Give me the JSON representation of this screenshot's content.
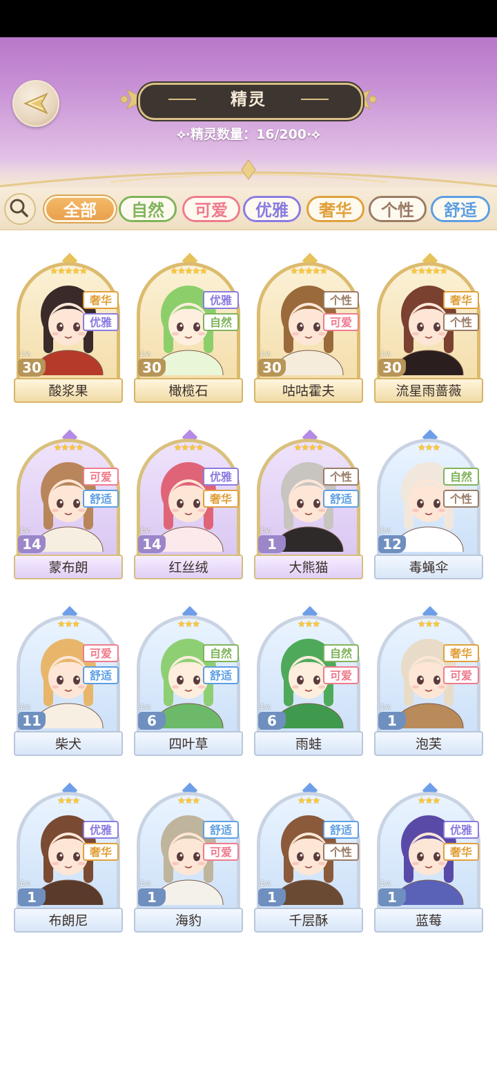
{
  "header": {
    "title": "精灵",
    "count_label": "精灵数量：",
    "count_value": "16/200"
  },
  "filters": [
    {
      "label": "全部",
      "selected": true,
      "color": "#e9a04c"
    },
    {
      "label": "自然",
      "selected": false,
      "color": "#7fb35a"
    },
    {
      "label": "可爱",
      "selected": false,
      "color": "#ef7b8d"
    },
    {
      "label": "优雅",
      "selected": false,
      "color": "#8a7be0"
    },
    {
      "label": "奢华",
      "selected": false,
      "color": "#e0a03a"
    },
    {
      "label": "个性",
      "selected": false,
      "color": "#9a7b66"
    },
    {
      "label": "舒适",
      "selected": false,
      "color": "#5b9ee3"
    }
  ],
  "tag_colors": {
    "奢华": "#e0a03a",
    "优雅": "#8a7be0",
    "自然": "#7fb35a",
    "个性": "#9a7b66",
    "可爱": "#ef7b8d",
    "舒适": "#5b9ee3"
  },
  "level_prefix": "Lv.",
  "spirits": [
    {
      "name": "酸浆果",
      "level": "30",
      "stars": 5,
      "rarity": "gold",
      "tags": [
        "奢华",
        "优雅"
      ]
    },
    {
      "name": "橄榄石",
      "level": "30",
      "stars": 5,
      "rarity": "gold",
      "tags": [
        "优雅",
        "自然"
      ]
    },
    {
      "name": "咕咕霍夫",
      "level": "30",
      "stars": 5,
      "rarity": "gold",
      "tags": [
        "个性",
        "可爱"
      ]
    },
    {
      "name": "流星雨蔷薇",
      "level": "30",
      "stars": 5,
      "rarity": "gold",
      "tags": [
        "奢华",
        "个性"
      ]
    },
    {
      "name": "蒙布朗",
      "level": "14",
      "stars": 4,
      "rarity": "purple",
      "tags": [
        "可爱",
        "舒适"
      ]
    },
    {
      "name": "红丝绒",
      "level": "14",
      "stars": 4,
      "rarity": "purple",
      "tags": [
        "优雅",
        "奢华"
      ]
    },
    {
      "name": "大熊猫",
      "level": "1",
      "stars": 4,
      "rarity": "purple",
      "tags": [
        "个性",
        "舒适"
      ]
    },
    {
      "name": "毒蝇伞",
      "level": "12",
      "stars": 3,
      "rarity": "blue",
      "tags": [
        "自然",
        "个性"
      ]
    },
    {
      "name": "柴犬",
      "level": "11",
      "stars": 3,
      "rarity": "blue",
      "tags": [
        "可爱",
        "舒适"
      ]
    },
    {
      "name": "四叶草",
      "level": "6",
      "stars": 3,
      "rarity": "blue",
      "tags": [
        "自然",
        "舒适"
      ]
    },
    {
      "name": "雨蛙",
      "level": "6",
      "stars": 3,
      "rarity": "blue",
      "tags": [
        "自然",
        "可爱"
      ]
    },
    {
      "name": "泡芙",
      "level": "1",
      "stars": 3,
      "rarity": "blue",
      "tags": [
        "奢华",
        "可爱"
      ]
    },
    {
      "name": "布朗尼",
      "level": "1",
      "stars": 3,
      "rarity": "blue",
      "tags": [
        "优雅",
        "奢华"
      ]
    },
    {
      "name": "海豹",
      "level": "1",
      "stars": 3,
      "rarity": "blue",
      "tags": [
        "舒适",
        "可爱"
      ]
    },
    {
      "name": "千层酥",
      "level": "1",
      "stars": 3,
      "rarity": "blue",
      "tags": [
        "舒适",
        "个性"
      ]
    },
    {
      "name": "蓝莓",
      "level": "1",
      "stars": 3,
      "rarity": "blue",
      "tags": [
        "优雅",
        "奢华"
      ]
    }
  ],
  "portrait_palette": {
    "酸浆果": {
      "hair": "#3a2a2a",
      "skin": "#fde6d6",
      "outfit": "#b53a2a"
    },
    "橄榄石": {
      "hair": "#8ccf6a",
      "skin": "#fdeedd",
      "outfit": "#e9f6d8"
    },
    "咕咕霍夫": {
      "hair": "#9a6a3a",
      "skin": "#fde6d6",
      "outfit": "#f5ecdc"
    },
    "流星雨蔷薇": {
      "hair": "#7a4030",
      "skin": "#fde6d6",
      "outfit": "#2a1e1e"
    },
    "蒙布朗": {
      "hair": "#b8865a",
      "skin": "#fde6d6",
      "outfit": "#f6efe1"
    },
    "红丝绒": {
      "hair": "#e06478",
      "skin": "#fde6d6",
      "outfit": "#fbe9ec"
    },
    "大熊猫": {
      "hair": "#c8c4c0",
      "skin": "#fde6d6",
      "outfit": "#2e2a2a"
    },
    "毒蝇伞": {
      "hair": "#f1e7dd",
      "skin": "#fde6d6",
      "outfit": "#ffffff"
    },
    "柴犬": {
      "hair": "#e8b66a",
      "skin": "#fde6d6",
      "outfit": "#f7efe2"
    },
    "四叶草": {
      "hair": "#8fcf73",
      "skin": "#fdeedd",
      "outfit": "#6db96a"
    },
    "雨蛙": {
      "hair": "#4eaa5a",
      "skin": "#fdeedd",
      "outfit": "#3f9a4e"
    },
    "泡芙": {
      "hair": "#e8dcc8",
      "skin": "#fde6d6",
      "outfit": "#b98a5a"
    },
    "布朗尼": {
      "hair": "#7a4a32",
      "skin": "#fde6d6",
      "outfit": "#5a3a2a"
    },
    "海豹": {
      "hair": "#bfb49c",
      "skin": "#fde6d6",
      "outfit": "#f4f1ea"
    },
    "千层酥": {
      "hair": "#8a5a3a",
      "skin": "#fde6d6",
      "outfit": "#6a4a32"
    },
    "蓝莓": {
      "hair": "#5a4aa8",
      "skin": "#fde6d6",
      "outfit": "#5a62b8"
    }
  }
}
